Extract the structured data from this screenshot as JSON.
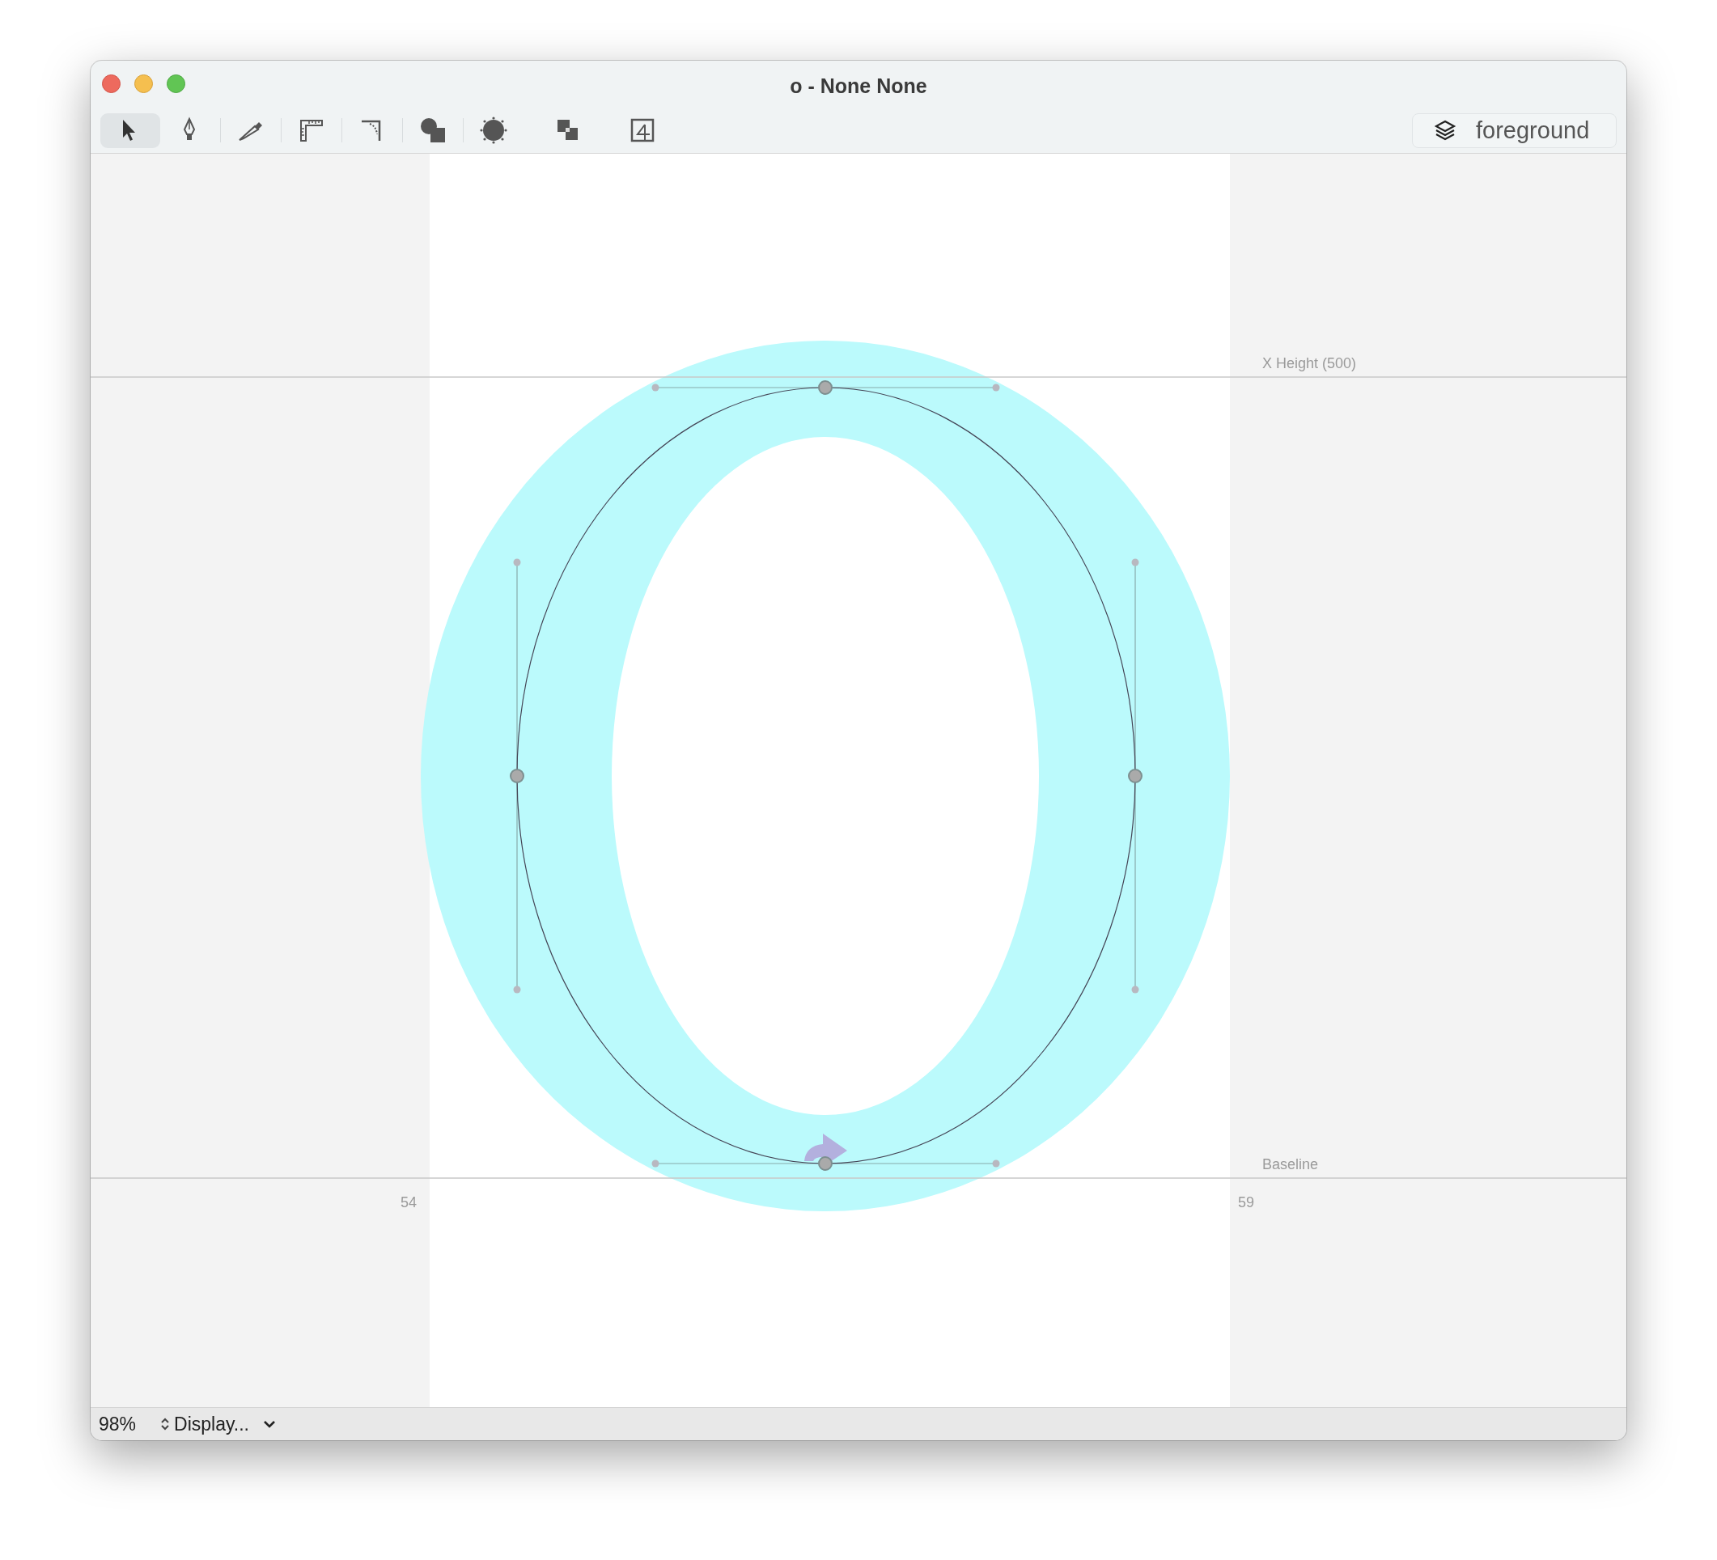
{
  "window": {
    "title": "o - None None"
  },
  "toolbar": {
    "tools": [
      {
        "kind": "select",
        "selected": true
      },
      {
        "kind": "pen",
        "selected": false
      },
      {
        "kind": "knife",
        "selected": false
      },
      {
        "kind": "measure",
        "selected": false
      },
      {
        "kind": "corner",
        "selected": false
      },
      {
        "kind": "shapes",
        "selected": false
      },
      {
        "kind": "blob",
        "selected": false
      },
      {
        "kind": "overlap",
        "selected": false
      },
      {
        "kind": "export",
        "selected": false
      }
    ],
    "layer": "foreground"
  },
  "canvas": {
    "guides": [
      {
        "kind": "xheight",
        "label": "X Height (500)"
      },
      {
        "kind": "baseline",
        "label": "Baseline"
      }
    ],
    "left_sidebearing": "54",
    "right_sidebearing": "59"
  },
  "status_bar": {
    "zoom": "98%",
    "display": "Display..."
  }
}
